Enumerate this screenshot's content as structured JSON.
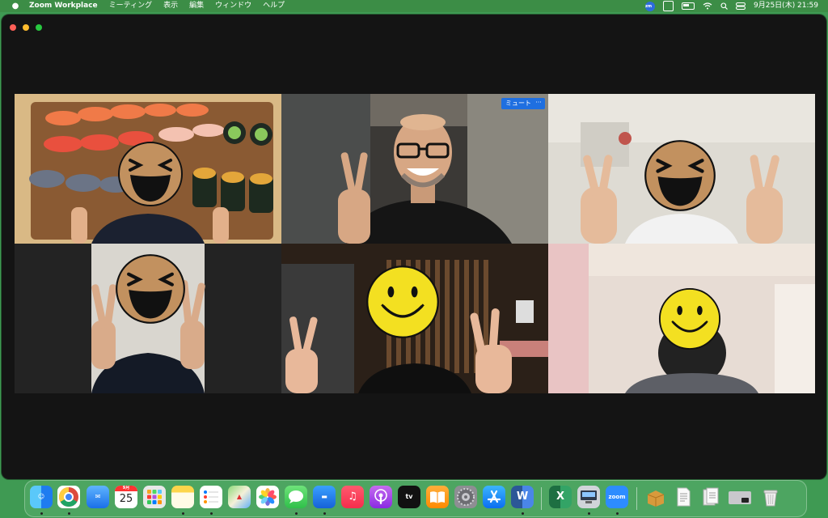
{
  "menubar": {
    "app_name": "Zoom Workplace",
    "menus": [
      "ミーティング",
      "表示",
      "編集",
      "ウィンドウ",
      "ヘルプ"
    ],
    "status_zoom": "zm",
    "datetime": "9月25日(木)  21:59"
  },
  "video": {
    "mute_label": "ミュート",
    "more_label": "···"
  },
  "dock": {
    "calendar_month": "9月",
    "calendar_day": "25",
    "tv_label": "tv",
    "zoom_label": "zoom",
    "word_label": "W",
    "excel_label": "X"
  },
  "colors": {
    "menubar": "#3c8c46",
    "desktop": "#3f9a53",
    "window_bg": "#141414",
    "active_speaker": "#4cc04a",
    "zoom_blue": "#1f6fe0"
  }
}
